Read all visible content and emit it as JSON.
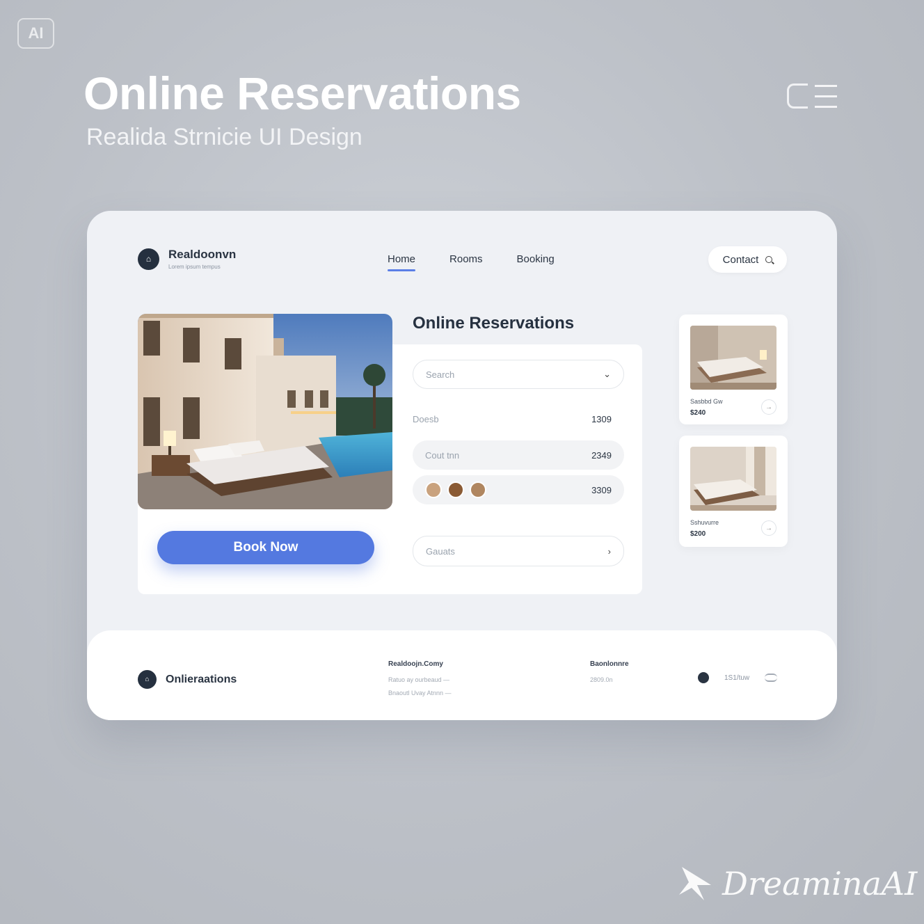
{
  "badge": {
    "label": "AI"
  },
  "hero": {
    "title": "Online Reservations",
    "subtitle": "Realida Strnicie UI Design"
  },
  "app": {
    "brand": {
      "name": "Realdoonvn",
      "tagline": "Lorem ipsum tempus"
    },
    "nav": [
      {
        "label": "Home",
        "active": true
      },
      {
        "label": "Rooms",
        "active": false
      },
      {
        "label": "Booking",
        "active": false
      }
    ],
    "contact_label": "Contact"
  },
  "main": {
    "title": "Online Reservations",
    "search": {
      "placeholder": "Search"
    },
    "rows": [
      {
        "label": "Doesb",
        "value": "1309"
      },
      {
        "label": "Cout tnn",
        "value": "2349"
      },
      {
        "label": "",
        "value": "3309"
      }
    ],
    "guests": {
      "placeholder": "Gauats"
    },
    "book_label": "Book Now"
  },
  "rooms": [
    {
      "name": "Sasbbd Gw",
      "price": "$240"
    },
    {
      "name": "Sshuvurre",
      "price": "$200"
    }
  ],
  "footer": {
    "brand": "Onlieraations",
    "col1": {
      "heading": "Realdoojn.Comy",
      "lines": [
        "Ratuo ay ourbeaud —",
        "Bnaoutl Uvay Atnnn —"
      ]
    },
    "col2": {
      "heading": "Baonlonnre",
      "lines": [
        "2809.0n"
      ]
    },
    "social_text": "1S1/tuw"
  },
  "watermark": {
    "text": "DreaminaAI"
  },
  "colors": {
    "accent": "#5479e0",
    "background": "#bfc3c9",
    "card": "#eff1f5",
    "dark": "#25303f"
  }
}
